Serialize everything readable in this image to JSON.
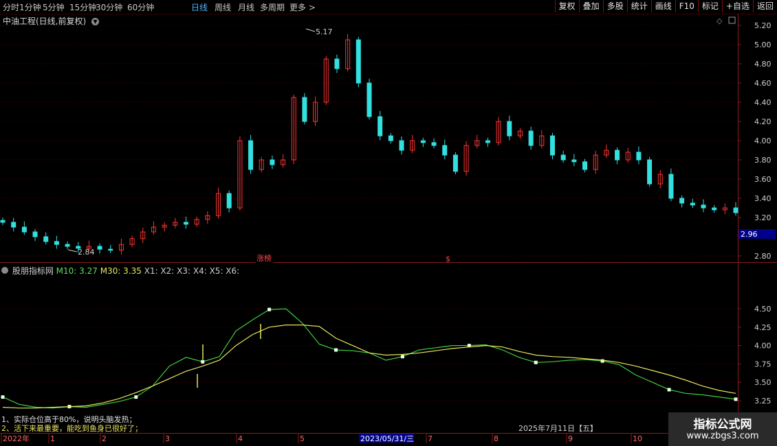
{
  "toolbar": {
    "periods": [
      {
        "label": "分时",
        "active": false
      },
      {
        "label": "1分钟",
        "active": false
      },
      {
        "label": "5分钟",
        "active": false
      },
      {
        "label": "15分钟",
        "active": false
      },
      {
        "label": "30分钟",
        "active": false
      },
      {
        "label": "60分钟",
        "active": false
      },
      {
        "label": "日线",
        "active": true
      },
      {
        "label": "周线",
        "active": false
      },
      {
        "label": "月线",
        "active": false
      },
      {
        "label": "多周期",
        "active": false
      },
      {
        "label": "更多 >",
        "active": false
      }
    ],
    "actions": [
      "复权",
      "叠加",
      "多股",
      "统计",
      "画线",
      "F10",
      "标记",
      "+自选",
      "返回"
    ]
  },
  "main_chart": {
    "title": "中油工程(日线,前复权)",
    "price_axis_ticks": [
      "5.20",
      "5.00",
      "4.80",
      "4.60",
      "4.40",
      "4.20",
      "4.00",
      "3.80",
      "3.60",
      "3.40",
      "3.20",
      "2.80"
    ],
    "current_price": "2.96",
    "high_label": "5.17",
    "low_label": "2.84",
    "event_label": "涨榜",
    "event_marker": "$"
  },
  "indicator": {
    "name": "股朋指标网",
    "m10_label": "M10: 3.27",
    "m30_label": "M30: 3.35",
    "extra": "X1: X2: X3: X4: X5: X6:",
    "axis_ticks": [
      "4.50",
      "4.25",
      "4.00",
      "3.75",
      "3.50",
      "3.25"
    ],
    "colors": {
      "m10": "#3ecf3e",
      "m30": "#e8e860",
      "up": "#ff3333",
      "down": "#33e0e0",
      "grid": "#5a0000"
    }
  },
  "notes": [
    "1、实际仓位高于80%，说明头脑发热；",
    "2、活下来最重要，能吃到鱼身已很好了；"
  ],
  "footer_date": "2025年7月11日【五】",
  "time_axis": {
    "labels": [
      "2022年",
      "1",
      "2",
      "3",
      "4",
      "5",
      "7",
      "8",
      "9",
      "10"
    ],
    "highlight": "2023/05/31/三"
  },
  "watermark": {
    "line1": "指标公式网",
    "line2": "www.zbgs3.com"
  },
  "chart_data": [
    {
      "type": "candlestick",
      "title": "中油工程(日线,前复权)",
      "ylim": [
        2.75,
        5.25
      ],
      "series": [
        {
          "name": "close (approx., sampled)",
          "values": [
            3.15,
            3.1,
            3.05,
            3.0,
            2.95,
            2.92,
            2.9,
            2.88,
            2.9,
            2.87,
            2.86,
            2.92,
            2.98,
            3.05,
            3.1,
            3.12,
            3.15,
            3.13,
            3.18,
            3.22,
            3.45,
            3.3,
            4.0,
            3.7,
            3.8,
            3.75,
            3.8,
            4.45,
            4.2,
            4.4,
            4.85,
            4.75,
            5.05,
            4.6,
            4.25,
            4.05,
            4.0,
            3.9,
            4.0,
            3.98,
            3.95,
            3.85,
            3.68,
            3.95,
            4.0,
            3.98,
            4.2,
            4.05,
            4.1,
            3.95,
            4.05,
            3.85,
            3.8,
            3.78,
            3.7,
            3.85,
            3.9,
            3.8,
            3.88,
            3.8,
            3.55,
            3.65,
            3.4,
            3.35,
            3.33,
            3.3,
            3.28,
            3.3,
            3.25
          ]
        }
      ]
    },
    {
      "type": "line",
      "title": "股朋指标网",
      "ylim": [
        3.1,
        4.7
      ],
      "series": [
        {
          "name": "M10",
          "values": [
            3.3,
            3.2,
            3.16,
            3.15,
            3.17,
            3.16,
            3.2,
            3.24,
            3.3,
            3.45,
            3.72,
            3.84,
            3.78,
            3.85,
            4.2,
            4.35,
            4.49,
            4.5,
            4.3,
            4.02,
            3.94,
            3.93,
            3.9,
            3.8,
            3.85,
            3.94,
            3.97,
            4.0,
            4.0,
            4.01,
            3.94,
            3.84,
            3.77,
            3.78,
            3.8,
            3.81,
            3.79,
            3.74,
            3.6,
            3.5,
            3.4,
            3.35,
            3.33,
            3.3,
            3.27
          ]
        },
        {
          "name": "M30",
          "values": [
            3.16,
            3.15,
            3.15,
            3.16,
            3.17,
            3.18,
            3.22,
            3.28,
            3.36,
            3.45,
            3.55,
            3.65,
            3.72,
            3.8,
            4.0,
            4.15,
            4.25,
            4.28,
            4.28,
            4.26,
            4.1,
            4.0,
            3.9,
            3.87,
            3.88,
            3.9,
            3.93,
            3.96,
            3.98,
            4.0,
            3.98,
            3.92,
            3.87,
            3.85,
            3.84,
            3.82,
            3.8,
            3.77,
            3.72,
            3.66,
            3.6,
            3.53,
            3.45,
            3.39,
            3.35
          ]
        }
      ]
    }
  ]
}
